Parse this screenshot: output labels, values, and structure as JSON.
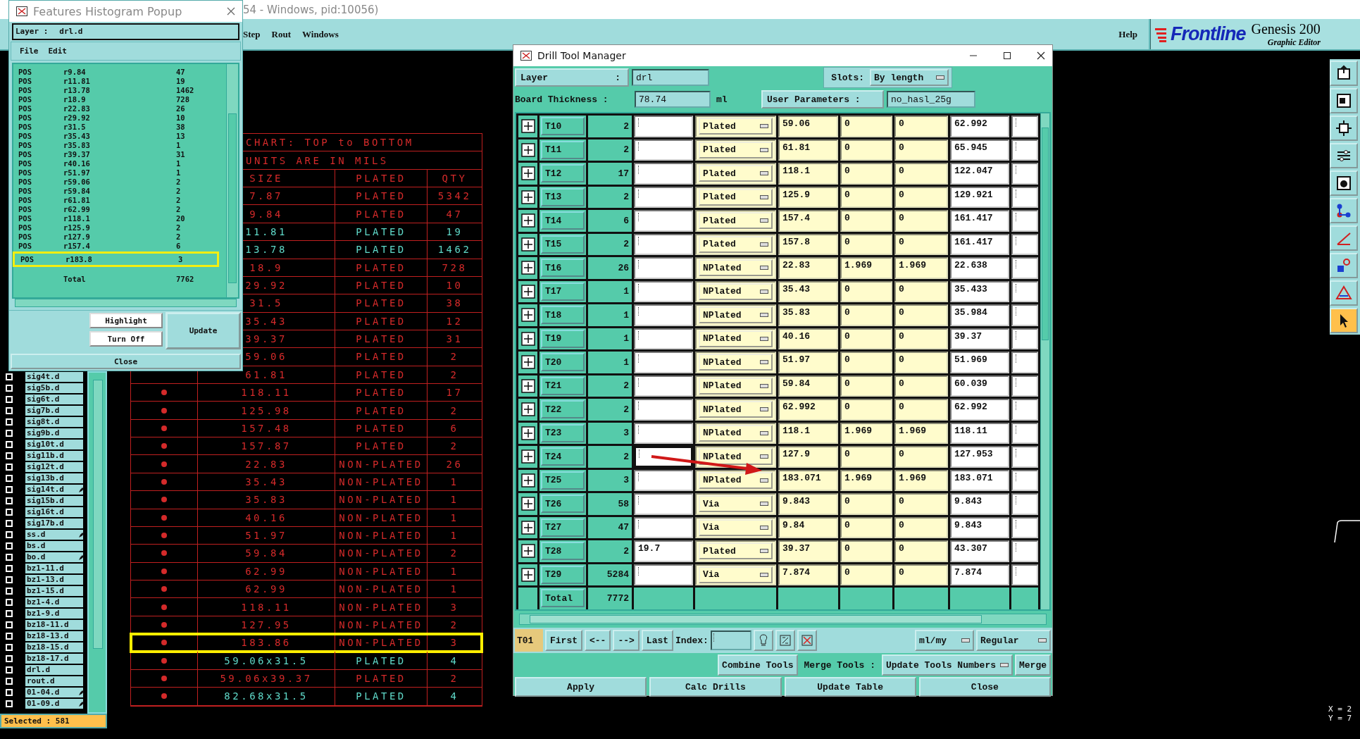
{
  "app": {
    "title": "54 - Windows, pid:10056)",
    "menu": [
      "Step",
      "Rout",
      "Windows"
    ],
    "help": "Help",
    "logo": "Frontline",
    "product": "Genesis 200",
    "subtitle": "Graphic Editor"
  },
  "histogram": {
    "title": "Features Histogram Popup",
    "layer_label": "Layer :",
    "layer": "drl.d",
    "menu": [
      "File",
      "Edit"
    ],
    "rows": [
      {
        "type": "POS",
        "symbol": "r9.84",
        "count": "47",
        "selected": false
      },
      {
        "type": "POS",
        "symbol": "r11.81",
        "count": "19",
        "selected": false
      },
      {
        "type": "POS",
        "symbol": "r13.78",
        "count": "1462",
        "selected": false
      },
      {
        "type": "POS",
        "symbol": "r18.9",
        "count": "728",
        "selected": false
      },
      {
        "type": "POS",
        "symbol": "r22.83",
        "count": "26",
        "selected": false
      },
      {
        "type": "POS",
        "symbol": "r29.92",
        "count": "10",
        "selected": false
      },
      {
        "type": "POS",
        "symbol": "r31.5",
        "count": "38",
        "selected": false
      },
      {
        "type": "POS",
        "symbol": "r35.43",
        "count": "13",
        "selected": false
      },
      {
        "type": "POS",
        "symbol": "r35.83",
        "count": "1",
        "selected": false
      },
      {
        "type": "POS",
        "symbol": "r39.37",
        "count": "31",
        "selected": false
      },
      {
        "type": "POS",
        "symbol": "r40.16",
        "count": "1",
        "selected": false
      },
      {
        "type": "POS",
        "symbol": "r51.97",
        "count": "1",
        "selected": false
      },
      {
        "type": "POS",
        "symbol": "r59.06",
        "count": "2",
        "selected": false
      },
      {
        "type": "POS",
        "symbol": "r59.84",
        "count": "2",
        "selected": false
      },
      {
        "type": "POS",
        "symbol": "r61.81",
        "count": "2",
        "selected": false
      },
      {
        "type": "POS",
        "symbol": "r62.99",
        "count": "2",
        "selected": false
      },
      {
        "type": "POS",
        "symbol": "r118.1",
        "count": "20",
        "selected": false
      },
      {
        "type": "POS",
        "symbol": "r125.9",
        "count": "2",
        "selected": false
      },
      {
        "type": "POS",
        "symbol": "r127.9",
        "count": "2",
        "selected": false
      },
      {
        "type": "POS",
        "symbol": "r157.4",
        "count": "6",
        "selected": false
      },
      {
        "type": "POS",
        "symbol": "r183.8",
        "count": "3",
        "selected": true
      }
    ],
    "total_label": "Total",
    "total": "7762",
    "buttons": [
      "Highlight",
      "Turn Off",
      "Update",
      "Close"
    ]
  },
  "layers": [
    {
      "name": "sig4t.d",
      "checked": false,
      "marked": false
    },
    {
      "name": "sig5b.d",
      "checked": false,
      "marked": false
    },
    {
      "name": "sig6t.d",
      "checked": false,
      "marked": false
    },
    {
      "name": "sig7b.d",
      "checked": false,
      "marked": false
    },
    {
      "name": "sig8t.d",
      "checked": false,
      "marked": false
    },
    {
      "name": "sig9b.d",
      "checked": false,
      "marked": false
    },
    {
      "name": "sig10t.d",
      "checked": false,
      "marked": false
    },
    {
      "name": "sig11b.d",
      "checked": false,
      "marked": false
    },
    {
      "name": "sig12t.d",
      "checked": false,
      "marked": false
    },
    {
      "name": "sig13b.d",
      "checked": false,
      "marked": false
    },
    {
      "name": "sig14t.d",
      "checked": false,
      "marked": true
    },
    {
      "name": "sig15b.d",
      "checked": false,
      "marked": false
    },
    {
      "name": "sig16t.d",
      "checked": false,
      "marked": false
    },
    {
      "name": "sig17b.d",
      "checked": false,
      "marked": false
    },
    {
      "name": "ss.d",
      "checked": false,
      "marked": true
    },
    {
      "name": "bs.d",
      "checked": false,
      "marked": false
    },
    {
      "name": "bo.d",
      "checked": false,
      "marked": true
    },
    {
      "name": "bz1-11.d",
      "checked": false,
      "marked": false
    },
    {
      "name": "bz1-13.d",
      "checked": false,
      "marked": false
    },
    {
      "name": "bz1-15.d",
      "checked": false,
      "marked": false
    },
    {
      "name": "bz1-4.d",
      "checked": false,
      "marked": false
    },
    {
      "name": "bz1-9.d",
      "checked": false,
      "marked": false
    },
    {
      "name": "bz18-11.d",
      "checked": false,
      "marked": false
    },
    {
      "name": "bz18-13.d",
      "checked": false,
      "marked": false
    },
    {
      "name": "bz18-15.d",
      "checked": false,
      "marked": false
    },
    {
      "name": "bz18-17.d",
      "checked": false,
      "marked": false
    },
    {
      "name": "drl.d",
      "checked": false,
      "marked": false
    },
    {
      "name": "rout.d",
      "checked": false,
      "marked": false
    },
    {
      "name": "01-04.d",
      "checked": false,
      "marked": true
    },
    {
      "name": "01-09.d",
      "checked": false,
      "marked": true
    }
  ],
  "selected_count": "Selected : 581",
  "chart": {
    "title": "CHART: TOP to BOTTOM",
    "units": "UNITS ARE IN MILS",
    "columns": [
      "SIZE",
      "PLATED",
      "QTY"
    ],
    "rows": [
      {
        "size": "7.87",
        "plating": "PLATED",
        "qty": "5342",
        "color": "#d42a2a",
        "selected": false
      },
      {
        "size": "9.84",
        "plating": "PLATED",
        "qty": "47",
        "color": "#d42a2a",
        "selected": false
      },
      {
        "size": "11.81",
        "plating": "PLATED",
        "qty": "19",
        "color": "#5fd8c8",
        "selected": false
      },
      {
        "size": "13.78",
        "plating": "PLATED",
        "qty": "1462",
        "color": "#5fd8c8",
        "selected": false
      },
      {
        "size": "18.9",
        "plating": "PLATED",
        "qty": "728",
        "color": "#d42a2a",
        "selected": false
      },
      {
        "size": "29.92",
        "plating": "PLATED",
        "qty": "10",
        "color": "#d42a2a",
        "selected": false
      },
      {
        "size": "31.5",
        "plating": "PLATED",
        "qty": "38",
        "color": "#d42a2a",
        "selected": false
      },
      {
        "size": "35.43",
        "plating": "PLATED",
        "qty": "12",
        "color": "#d42a2a",
        "selected": false
      },
      {
        "size": "39.37",
        "plating": "PLATED",
        "qty": "31",
        "color": "#d42a2a",
        "selected": false
      },
      {
        "size": "59.06",
        "plating": "PLATED",
        "qty": "2",
        "color": "#d42a2a",
        "selected": false
      },
      {
        "size": "61.81",
        "plating": "PLATED",
        "qty": "2",
        "color": "#d42a2a",
        "selected": false
      },
      {
        "size": "118.11",
        "plating": "PLATED",
        "qty": "17",
        "color": "#d42a2a",
        "selected": false
      },
      {
        "size": "125.98",
        "plating": "PLATED",
        "qty": "2",
        "color": "#d42a2a",
        "selected": false
      },
      {
        "size": "157.48",
        "plating": "PLATED",
        "qty": "6",
        "color": "#d42a2a",
        "selected": false
      },
      {
        "size": "157.87",
        "plating": "PLATED",
        "qty": "2",
        "color": "#d42a2a",
        "selected": false
      },
      {
        "size": "22.83",
        "plating": "NON-PLATED",
        "qty": "26",
        "color": "#d42a2a",
        "selected": false
      },
      {
        "size": "35.43",
        "plating": "NON-PLATED",
        "qty": "1",
        "color": "#d42a2a",
        "selected": false
      },
      {
        "size": "35.83",
        "plating": "NON-PLATED",
        "qty": "1",
        "color": "#d42a2a",
        "selected": false
      },
      {
        "size": "40.16",
        "plating": "NON-PLATED",
        "qty": "1",
        "color": "#d42a2a",
        "selected": false
      },
      {
        "size": "51.97",
        "plating": "NON-PLATED",
        "qty": "1",
        "color": "#d42a2a",
        "selected": false
      },
      {
        "size": "59.84",
        "plating": "NON-PLATED",
        "qty": "2",
        "color": "#d42a2a",
        "selected": false
      },
      {
        "size": "62.99",
        "plating": "NON-PLATED",
        "qty": "1",
        "color": "#d42a2a",
        "selected": false
      },
      {
        "size": "62.99",
        "plating": "NON-PLATED",
        "qty": "1",
        "color": "#d42a2a",
        "selected": false
      },
      {
        "size": "118.11",
        "plating": "NON-PLATED",
        "qty": "3",
        "color": "#d42a2a",
        "selected": false
      },
      {
        "size": "127.95",
        "plating": "NON-PLATED",
        "qty": "2",
        "color": "#d42a2a",
        "selected": false
      },
      {
        "size": "183.86",
        "plating": "NON-PLATED",
        "qty": "3",
        "color": "#d42a2a",
        "selected": true
      },
      {
        "size": "59.06x31.5",
        "plating": "PLATED",
        "qty": "4",
        "color": "#5fd8c8",
        "selected": false
      },
      {
        "size": "59.06x39.37",
        "plating": "PLATED",
        "qty": "2",
        "color": "#d42a2a",
        "selected": false
      },
      {
        "size": "82.68x31.5",
        "plating": "PLATED",
        "qty": "4",
        "color": "#5fd8c8",
        "selected": false
      }
    ]
  },
  "drill_tool_manager": {
    "title": "Drill Tool Manager",
    "layer_label": "Layer",
    "layer_colon": ":",
    "layer": "drl",
    "slots_label": "Slots:",
    "slots": "By length",
    "thickness_label": "Board Thickness :",
    "thickness": "78.74",
    "thickness_unit": "ml",
    "user_params_label": "User Parameters :",
    "user_params": "no_hasl_25g",
    "tools": [
      {
        "tool": "T10",
        "count": "2",
        "type": "Plated",
        "values": [
          "59.06",
          "0",
          "0",
          "62.992"
        ],
        "focused": false
      },
      {
        "tool": "T11",
        "count": "2",
        "type": "Plated",
        "values": [
          "61.81",
          "0",
          "0",
          "65.945"
        ],
        "focused": false
      },
      {
        "tool": "T12",
        "count": "17",
        "type": "Plated",
        "values": [
          "118.1",
          "0",
          "0",
          "122.047"
        ],
        "focused": false
      },
      {
        "tool": "T13",
        "count": "2",
        "type": "Plated",
        "values": [
          "125.9",
          "0",
          "0",
          "129.921"
        ],
        "focused": false
      },
      {
        "tool": "T14",
        "count": "6",
        "type": "Plated",
        "values": [
          "157.4",
          "0",
          "0",
          "161.417"
        ],
        "focused": false
      },
      {
        "tool": "T15",
        "count": "2",
        "type": "Plated",
        "values": [
          "157.8",
          "0",
          "0",
          "161.417"
        ],
        "focused": false
      },
      {
        "tool": "T16",
        "count": "26",
        "type": "NPlated",
        "values": [
          "22.83",
          "1.969",
          "1.969",
          "22.638"
        ],
        "focused": false
      },
      {
        "tool": "T17",
        "count": "1",
        "type": "NPlated",
        "values": [
          "35.43",
          "0",
          "0",
          "35.433"
        ],
        "focused": false
      },
      {
        "tool": "T18",
        "count": "1",
        "type": "NPlated",
        "values": [
          "35.83",
          "0",
          "0",
          "35.984"
        ],
        "focused": false
      },
      {
        "tool": "T19",
        "count": "1",
        "type": "NPlated",
        "values": [
          "40.16",
          "0",
          "0",
          "39.37"
        ],
        "focused": false
      },
      {
        "tool": "T20",
        "count": "1",
        "type": "NPlated",
        "values": [
          "51.97",
          "0",
          "0",
          "51.969"
        ],
        "focused": false
      },
      {
        "tool": "T21",
        "count": "2",
        "type": "NPlated",
        "values": [
          "59.84",
          "0",
          "0",
          "60.039"
        ],
        "focused": false
      },
      {
        "tool": "T22",
        "count": "2",
        "type": "NPlated",
        "values": [
          "62.992",
          "0",
          "0",
          "62.992"
        ],
        "focused": false
      },
      {
        "tool": "T23",
        "count": "3",
        "type": "NPlated",
        "values": [
          "118.1",
          "1.969",
          "1.969",
          "118.11"
        ],
        "focused": false
      },
      {
        "tool": "T24",
        "count": "2",
        "type": "NPlated",
        "values": [
          "127.9",
          "0",
          "0",
          "127.953"
        ],
        "focused": true
      },
      {
        "tool": "T25",
        "count": "3",
        "type": "NPlated",
        "values": [
          "183.071",
          "1.969",
          "1.969",
          "183.071"
        ],
        "focused": false
      },
      {
        "tool": "T26",
        "count": "58",
        "type": "Via",
        "values": [
          "9.843",
          "0",
          "0",
          "9.843"
        ],
        "focused": false
      },
      {
        "tool": "T27",
        "count": "47",
        "type": "Via",
        "values": [
          "9.84",
          "0",
          "0",
          "9.843"
        ],
        "focused": false
      },
      {
        "tool": "T28",
        "count": "2",
        "column_4": "19.7",
        "type": "Plated",
        "values": [
          "39.37",
          "0",
          "0",
          "43.307"
        ],
        "focused": false
      },
      {
        "tool": "T29",
        "count": "5284",
        "type": "Via",
        "values": [
          "7.874",
          "0",
          "0",
          "7.874"
        ],
        "focused": false
      }
    ],
    "total_label": "Total",
    "total": "7772",
    "current_tool": "T01",
    "nav_buttons": [
      "First",
      "<--",
      "-->",
      "Last"
    ],
    "index_label": "Index:",
    "units": "ml/my",
    "mode": "Regular",
    "combine_button": "Combine Tools",
    "merge_label": "Merge Tools :",
    "merge_option": "Update Tools Numbers",
    "merge_button": "Merge",
    "actions": [
      "Apply",
      "Calc Drills",
      "Update Table",
      "Close"
    ]
  },
  "toolbar": [
    {
      "selected": false
    },
    {
      "selected": false
    },
    {
      "selected": false
    },
    {
      "selected": false
    },
    {
      "selected": false
    },
    {
      "selected": false
    },
    {
      "selected": false
    },
    {
      "selected": false
    },
    {
      "selected": false
    },
    {
      "selected": true
    }
  ],
  "coordinates": [
    "X = 2",
    "Y = 7"
  ]
}
